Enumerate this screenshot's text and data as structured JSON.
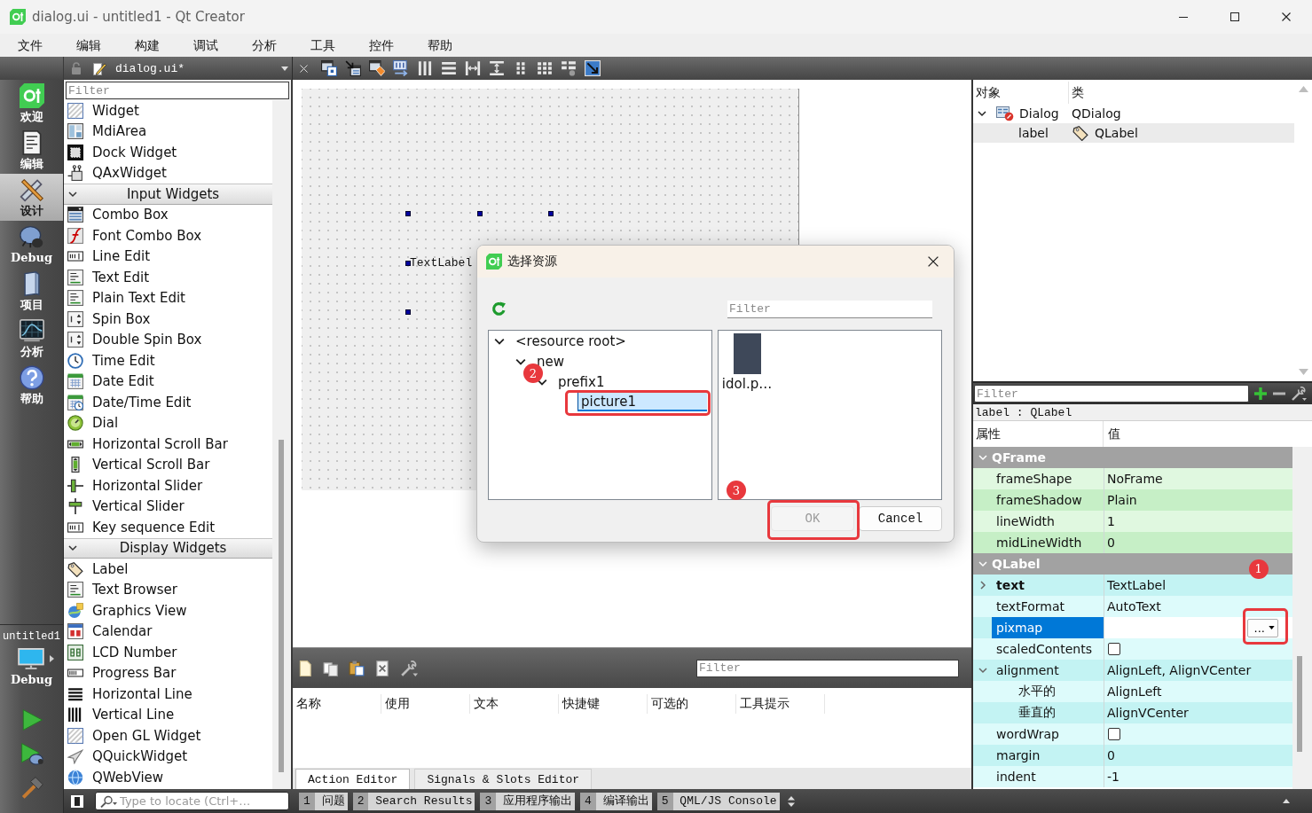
{
  "window": {
    "title": "dialog.ui - untitled1 - Qt Creator"
  },
  "menu_bar": [
    "文件",
    "编辑",
    "构建",
    "调试",
    "分析",
    "工具",
    "控件",
    "帮助"
  ],
  "mode_bar": {
    "modes": [
      {
        "label": "欢迎",
        "selected": false
      },
      {
        "label": "编辑",
        "selected": false
      },
      {
        "label": "设计",
        "selected": true
      },
      {
        "label": "Debug",
        "selected": false
      },
      {
        "label": "项目",
        "selected": false
      },
      {
        "label": "分析",
        "selected": false
      },
      {
        "label": "帮助",
        "selected": false
      }
    ],
    "target": {
      "project": "untitled1",
      "build": "Debug"
    }
  },
  "editor_toolbar": {
    "document": "dialog.ui*"
  },
  "widget_box": {
    "filter": {
      "placeholder": "Filter"
    },
    "items": [
      {
        "kind": "widget",
        "label": "Widget"
      },
      {
        "kind": "widget",
        "label": "MdiArea"
      },
      {
        "kind": "widget",
        "label": "Dock Widget"
      },
      {
        "kind": "widget",
        "label": "QAxWidget"
      },
      {
        "kind": "category",
        "label": "Input Widgets",
        "expanded": true
      },
      {
        "kind": "widget",
        "label": "Combo Box"
      },
      {
        "kind": "widget",
        "label": "Font Combo Box"
      },
      {
        "kind": "widget",
        "label": "Line Edit"
      },
      {
        "kind": "widget",
        "label": "Text Edit"
      },
      {
        "kind": "widget",
        "label": "Plain Text Edit"
      },
      {
        "kind": "widget",
        "label": "Spin Box"
      },
      {
        "kind": "widget",
        "label": "Double Spin Box"
      },
      {
        "kind": "widget",
        "label": "Time Edit"
      },
      {
        "kind": "widget",
        "label": "Date Edit"
      },
      {
        "kind": "widget",
        "label": "Date/Time Edit"
      },
      {
        "kind": "widget",
        "label": "Dial"
      },
      {
        "kind": "widget",
        "label": "Horizontal Scroll Bar"
      },
      {
        "kind": "widget",
        "label": "Vertical Scroll Bar"
      },
      {
        "kind": "widget",
        "label": "Horizontal Slider"
      },
      {
        "kind": "widget",
        "label": "Vertical Slider"
      },
      {
        "kind": "widget",
        "label": "Key sequence Edit"
      },
      {
        "kind": "category",
        "label": "Display Widgets",
        "expanded": true
      },
      {
        "kind": "widget",
        "label": "Label"
      },
      {
        "kind": "widget",
        "label": "Text Browser"
      },
      {
        "kind": "widget",
        "label": "Graphics View"
      },
      {
        "kind": "widget",
        "label": "Calendar"
      },
      {
        "kind": "widget",
        "label": "LCD Number"
      },
      {
        "kind": "widget",
        "label": "Progress Bar"
      },
      {
        "kind": "widget",
        "label": "Horizontal Line"
      },
      {
        "kind": "widget",
        "label": "Vertical Line"
      },
      {
        "kind": "widget",
        "label": "Open GL Widget"
      },
      {
        "kind": "widget",
        "label": "QQuickWidget"
      },
      {
        "kind": "widget",
        "label": "QWebView"
      }
    ]
  },
  "form": {
    "label": {
      "text": "TextLabel",
      "selected": true
    }
  },
  "resource_dialog": {
    "title": "选择资源",
    "filter": {
      "placeholder": "Filter"
    },
    "tree": [
      {
        "label": "<resource root>",
        "expanded": true,
        "children": [
          {
            "label": "new",
            "expanded": true,
            "children": [
              {
                "label": "prefix1",
                "expanded": true,
                "children": [
                  {
                    "label": "picture1",
                    "editing": true,
                    "callout": "2"
                  }
                ]
              }
            ]
          }
        ]
      }
    ],
    "files": [
      {
        "name": "idol.p…"
      }
    ],
    "buttons": [
      {
        "label": "OK",
        "disabled": true,
        "callout": "3"
      },
      {
        "label": "Cancel",
        "disabled": false
      }
    ]
  },
  "object_inspector": {
    "columns": [
      "对象",
      "类"
    ],
    "rows": [
      {
        "object": "Dialog",
        "class": "QDialog",
        "selected": false,
        "expanded": true,
        "children": [
          {
            "object": "label",
            "class": "QLabel",
            "selected": true
          }
        ]
      }
    ]
  },
  "property_editor": {
    "filter": {
      "placeholder": "Filter"
    },
    "object_label": "label : QLabel",
    "columns": [
      "属性",
      "值"
    ],
    "groups": [
      {
        "name": "QFrame",
        "expanded": true,
        "properties": [
          {
            "kind": "text",
            "name": "frameShape",
            "value": "NoFrame",
            "selected": false,
            "modified": false
          },
          {
            "kind": "text",
            "name": "frameShadow",
            "value": "Plain",
            "selected": false,
            "modified": false
          },
          {
            "kind": "text",
            "name": "lineWidth",
            "value": "1",
            "selected": false,
            "modified": false
          },
          {
            "kind": "text",
            "name": "midLineWidth",
            "value": "0",
            "selected": false,
            "modified": false
          }
        ]
      },
      {
        "name": "QLabel",
        "expanded": true,
        "properties": [
          {
            "kind": "compound",
            "name": "text",
            "value": "TextLabel",
            "expanded": false,
            "selected": false,
            "modified": true
          },
          {
            "kind": "text",
            "name": "textFormat",
            "value": "AutoText",
            "selected": false,
            "modified": false
          },
          {
            "kind": "pixmap",
            "name": "pixmap",
            "button": "...",
            "callout": "1",
            "selected": true,
            "modified": false
          },
          {
            "kind": "checkbox",
            "name": "scaledContents",
            "checked": false,
            "selected": false,
            "modified": false
          },
          {
            "kind": "compound",
            "name": "alignment",
            "value": "AlignLeft, AlignVCenter",
            "expanded": true,
            "selected": false,
            "modified": false,
            "children": [
              {
                "kind": "text",
                "name": "水平的",
                "value": "AlignLeft",
                "selected": false,
                "modified": false
              },
              {
                "kind": "text",
                "name": "垂直的",
                "value": "AlignVCenter",
                "selected": false,
                "modified": false
              }
            ]
          },
          {
            "kind": "checkbox",
            "name": "wordWrap",
            "checked": false,
            "selected": false,
            "modified": false
          },
          {
            "kind": "text",
            "name": "margin",
            "value": "0",
            "selected": false,
            "modified": false
          },
          {
            "kind": "text",
            "name": "indent",
            "value": "-1",
            "selected": false,
            "modified": false
          }
        ]
      }
    ]
  },
  "action_editor": {
    "filter": {
      "placeholder": "Filter"
    },
    "columns": [
      "名称",
      "使用",
      "文本",
      "快捷键",
      "可选的",
      "工具提示"
    ],
    "tabs": [
      {
        "label": "Action Editor",
        "selected": true
      },
      {
        "label": "Signals & Slots Editor",
        "selected": false
      }
    ]
  },
  "status_bar": {
    "locator": {
      "placeholder": "Type to locate (Ctrl+…"
    },
    "panes": [
      {
        "number": "1",
        "label": "问题"
      },
      {
        "number": "2",
        "label": "Search Results"
      },
      {
        "number": "3",
        "label": "应用程序输出"
      },
      {
        "number": "4",
        "label": "编译输出"
      },
      {
        "number": "5",
        "label": "QML/JS Console"
      }
    ]
  }
}
